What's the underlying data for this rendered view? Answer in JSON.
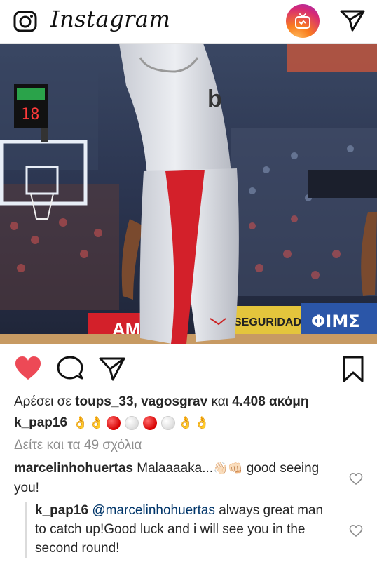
{
  "header": {
    "brand": "Instagram",
    "icons": {
      "camera": "camera-icon",
      "igtv": "igtv-icon",
      "direct": "direct-message-icon"
    }
  },
  "post": {
    "icons": {
      "like": "heart-filled-icon",
      "comment": "comment-icon",
      "share": "share-icon",
      "save": "bookmark-icon"
    },
    "likes": {
      "prefix": "Αρέσει σε",
      "users": "toups_33, vagosgrav",
      "joiner": "και",
      "count": "4.408 ακόμη"
    },
    "caption": {
      "username": "k_pap16",
      "emoji_sequence": [
        "ok-hand",
        "ok-hand",
        "red-circle",
        "white-circle",
        "red-circle",
        "white-circle",
        "ok-hand",
        "ok-hand"
      ]
    },
    "view_comments": "Δείτε και τα 49 σχόλια",
    "comments": [
      {
        "username": "marcelinhohuertas",
        "text_before": "Malaaaaka...",
        "emojis": [
          "waving-hand",
          "fist"
        ],
        "text_after": "good seeing you!"
      },
      {
        "username": "k_pap16",
        "mention": "@marcelinhohuertas",
        "text": "always great man to catch up!Good luck and i will see you in the second round!"
      }
    ]
  },
  "photo": {
    "board_text_1": "AM",
    "board_text_2": "SEGURIDAD",
    "board_text_3": "ΦΙΜΣ",
    "shot_clock": "18"
  },
  "colors": {
    "like_red": "#ed4956",
    "link_blue": "#003569",
    "muted": "#8e8e8e"
  }
}
